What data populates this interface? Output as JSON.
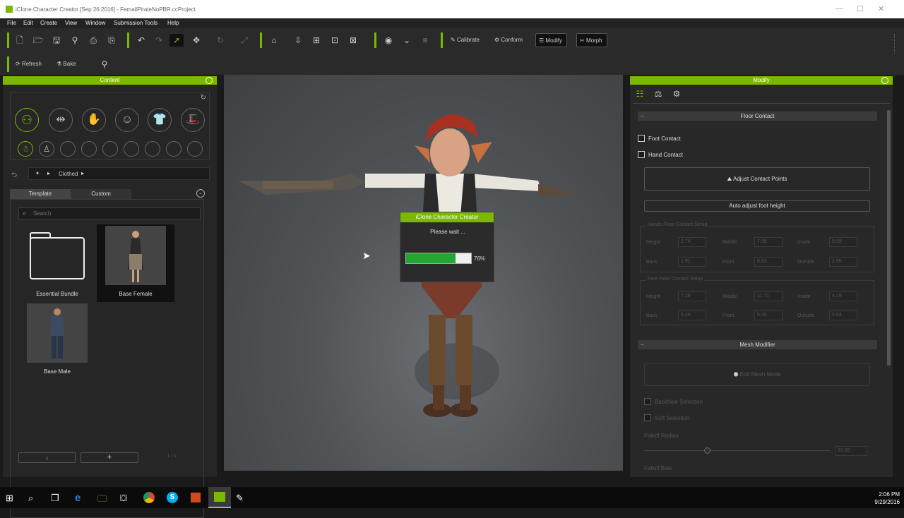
{
  "window": {
    "title": "iClone Character Creator [Sep 26 2016] - FemailPirateNoPBR.ccProject",
    "minimize": "—",
    "maximize": "☐",
    "close": "✕"
  },
  "menu": [
    "File",
    "Edit",
    "Create",
    "View",
    "Window",
    "Submission Tools",
    "Help"
  ],
  "toolbar": {
    "calibrate": "Calibrate",
    "conform": "Conform",
    "modify": "Modify",
    "morph": "Morph",
    "refresh": "Refresh",
    "bake": "Bake"
  },
  "content": {
    "header": "Content",
    "breadcrumb": "Clothed",
    "tabs": [
      "Template",
      "Custom"
    ],
    "search_placeholder": "Search",
    "items": [
      {
        "label": "Essential Bundle"
      },
      {
        "label": "Base Female"
      },
      {
        "label": "Base Male"
      }
    ],
    "footer_page": "1 / 1"
  },
  "dialog": {
    "title": "iClone Character Creator",
    "message": "Please wait ...",
    "progress_pct": 76,
    "progress_label": "76%"
  },
  "modify": {
    "header": "Modify",
    "floor_contact": "Floor Contact",
    "foot_contact": "Foot Contact",
    "hand_contact": "Hand Contact",
    "adjust_contact_points": "Adjust Contact Points",
    "auto_adjust": "Auto adjust foot height",
    "hands_group": {
      "title": "Hands Floor Contact Setup",
      "row1": [
        {
          "label": "Height",
          "value": "2.74"
        },
        {
          "label": "Middle",
          "value": "7.98"
        },
        {
          "label": "Inside",
          "value": "9.99"
        }
      ],
      "row2": [
        {
          "label": "Back",
          "value": "1.91"
        },
        {
          "label": "Front",
          "value": "8.63"
        },
        {
          "label": "Outside",
          "value": "2.95"
        }
      ]
    },
    "feet_group": {
      "title": "Feet Floor Contact Setup",
      "row1": [
        {
          "label": "Height",
          "value": "7.28"
        },
        {
          "label": "Middle",
          "value": "11.71"
        },
        {
          "label": "Inside",
          "value": "4.29"
        }
      ],
      "row2": [
        {
          "label": "Back",
          "value": "5.49"
        },
        {
          "label": "Front",
          "value": "5.00"
        },
        {
          "label": "Outside",
          "value": "5.64"
        }
      ]
    },
    "mesh_modifier": "Mesh Modifier",
    "edit_mesh_mode": "Edit Mesh Mode",
    "backface_selection": "Backface Selection",
    "soft_selection": "Soft Selection",
    "falloff_radius": "Falloff Radius",
    "falloff_radius_value": "10.00",
    "falloff_bias": "Falloff Bias"
  },
  "taskbar": {
    "time": "2:06 PM",
    "date": "9/29/2016"
  },
  "colors": {
    "accent": "#7cb800",
    "progress": "#22a832"
  }
}
